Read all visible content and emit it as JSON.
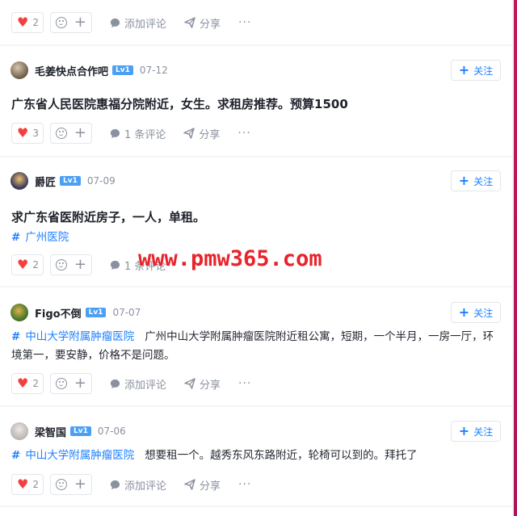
{
  "watermark": "www.pmw365.com",
  "common": {
    "follow_label": "关注",
    "comment_label": "添加评论",
    "share_label": "分享",
    "more_label": "···"
  },
  "posts": [
    {
      "likes": "2"
    },
    {
      "author": "毛姜快点合作吧",
      "level": "Lv1",
      "date": "07-12",
      "title": "广东省人民医院惠福分院附近，女生。求租房推荐。预算1500",
      "likes": "3",
      "comments": "1 条评论"
    },
    {
      "author": "爵匠",
      "level": "Lv1",
      "date": "07-09",
      "title": "求广东省医附近房子，一人，单租。",
      "tag": "广州医院",
      "likes": "2",
      "comments": "1 条评论"
    },
    {
      "author": "Figo不倒",
      "level": "Lv1",
      "date": "07-07",
      "tag": "中山大学附属肿瘤医院",
      "text": "广州中山大学附属肿瘤医院附近租公寓，短期，一个半月，一房一厅，环境第一，要安静，价格不是问题。",
      "likes": "2"
    },
    {
      "author": "梁智国",
      "level": "Lv1",
      "date": "07-06",
      "tag": "中山大学附属肿瘤医院",
      "text": "想要租一个。越秀东风东路附近，轮椅可以到的。拜托了",
      "likes": "2"
    }
  ],
  "colors": {
    "accent": "#1e80ff",
    "like": "#f53f3f",
    "level_badge": "#4ba0f5",
    "watermark": "#e8232b"
  }
}
